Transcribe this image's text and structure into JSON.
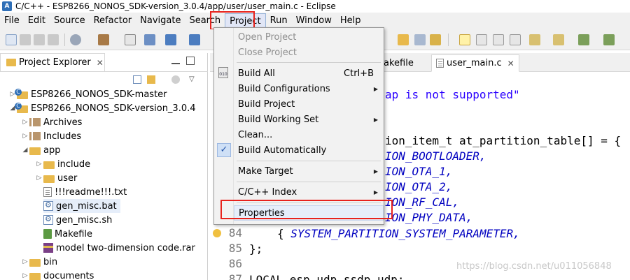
{
  "window": {
    "title": "C/C++ - ESP8266_NONOS_SDK-version_3.0.4/app/user/user_main.c - Eclipse"
  },
  "menubar": {
    "items": [
      "File",
      "Edit",
      "Source",
      "Refactor",
      "Navigate",
      "Search",
      "Project",
      "Run",
      "Window",
      "Help"
    ],
    "active": "Project"
  },
  "project_menu": {
    "items": [
      {
        "label": "Open Project",
        "enabled": false
      },
      {
        "label": "Close Project",
        "enabled": false
      },
      {
        "label": "Build All",
        "accelerator": "Ctrl+B",
        "icon": "build-all-icon"
      },
      {
        "label": "Build Configurations",
        "submenu": true
      },
      {
        "label": "Build Project"
      },
      {
        "label": "Build Working Set",
        "submenu": true
      },
      {
        "label": "Clean..."
      },
      {
        "label": "Build Automatically",
        "checked": true
      },
      {
        "label": "Make Target",
        "submenu": true
      },
      {
        "label": "C/C++ Index",
        "submenu": true
      },
      {
        "label": "Properties",
        "highlighted": true
      }
    ]
  },
  "project_explorer": {
    "tab_label": "Project Explorer",
    "tree": [
      {
        "label": "ESP8266_NONOS_SDK-master",
        "icon": "c-project-icon"
      },
      {
        "label": "ESP8266_NONOS_SDK-version_3.0.4",
        "icon": "c-project-icon"
      },
      {
        "label": "Archives",
        "icon": "archive-icon"
      },
      {
        "label": "Includes",
        "icon": "includes-icon"
      },
      {
        "label": "app",
        "icon": "source-folder-icon"
      },
      {
        "label": "include",
        "icon": "folder-icon"
      },
      {
        "label": "user",
        "icon": "source-folder-icon"
      },
      {
        "label": "!!!readme!!!.txt",
        "icon": "text-file-icon"
      },
      {
        "label": "gen_misc.bat",
        "icon": "script-file-icon",
        "selected": true
      },
      {
        "label": "gen_misc.sh",
        "icon": "script-file-icon"
      },
      {
        "label": "Makefile",
        "icon": "makefile-icon"
      },
      {
        "label": "model two-dimension code.rar",
        "icon": "rar-file-icon"
      },
      {
        "label": "bin",
        "icon": "folder-icon"
      },
      {
        "label": "documents",
        "icon": "folder-icon"
      }
    ]
  },
  "editor": {
    "tabs": [
      "akefile",
      "user_main.c"
    ],
    "active_tab": "user_main.c",
    "code": [
      {
        "text": "ap is not supported\"",
        "kind": "string"
      },
      {
        "text": "ion_item_t at_partition_table[] = {",
        "kind": "plain"
      },
      {
        "text": "ION_BOOTLOADER,",
        "kind": "enum"
      },
      {
        "text": "ION_OTA_1,",
        "kind": "enum"
      },
      {
        "text": "ION_OTA_2,",
        "kind": "enum"
      },
      {
        "text": "ION_RF_CAL,",
        "kind": "enum"
      },
      {
        "text": "ION_PHY_DATA,",
        "kind": "enum"
      },
      {
        "text": "SYSTEM_PARTITION_SYSTEM_PARAMETER,",
        "kind": "enum"
      },
      {
        "text": "};",
        "kind": "plain"
      },
      {
        "text": "",
        "kind": "plain"
      },
      {
        "text": "LOCAL esp_udp ssdp_udp;",
        "kind": "plain"
      }
    ],
    "line_numbers": [
      "84",
      "85",
      "86",
      "87"
    ],
    "line84_prefix": "{ ",
    "line84_suffix": ","
  },
  "watermark": "https://blog.csdn.net/u011056848",
  "colors": {
    "highlight_border": "#e8231d",
    "string": "#2a00ff",
    "enum_constant": "#0000c0",
    "line_number": "#787878"
  }
}
